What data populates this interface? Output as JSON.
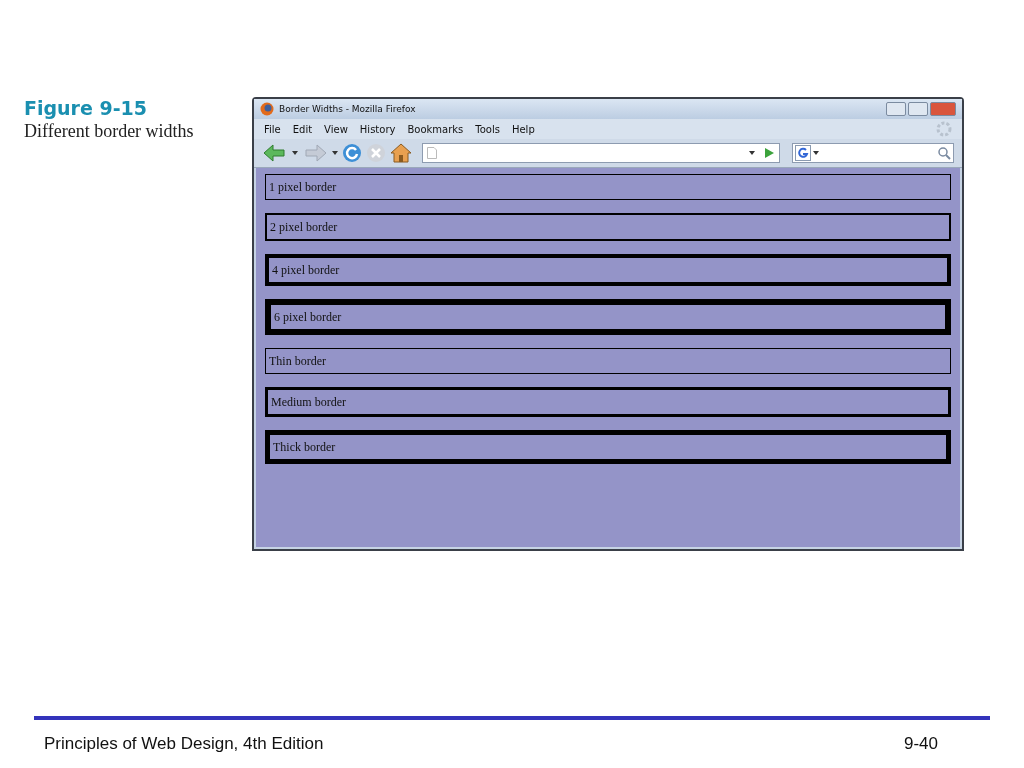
{
  "caption": {
    "figure": "Figure 9-15",
    "title": "Different border widths"
  },
  "window": {
    "title": "Border Widths - Mozilla Firefox"
  },
  "menu": [
    "File",
    "Edit",
    "View",
    "History",
    "Bookmarks",
    "Tools",
    "Help"
  ],
  "boxes": [
    {
      "label": "1 pixel border",
      "kind": "hairline"
    },
    {
      "label": "2 pixel border",
      "kind": "fine"
    },
    {
      "label": "4 pixel border",
      "kind": "heavy"
    },
    {
      "label": "6 pixel border",
      "kind": "heaviest"
    },
    {
      "label": "Thin border",
      "kind": "thin"
    },
    {
      "label": "Medium border",
      "kind": "medium"
    },
    {
      "label": "Thick border",
      "kind": "thick"
    }
  ],
  "footer": {
    "left": "Principles of Web Design, 4th Edition",
    "right": "9-40"
  }
}
